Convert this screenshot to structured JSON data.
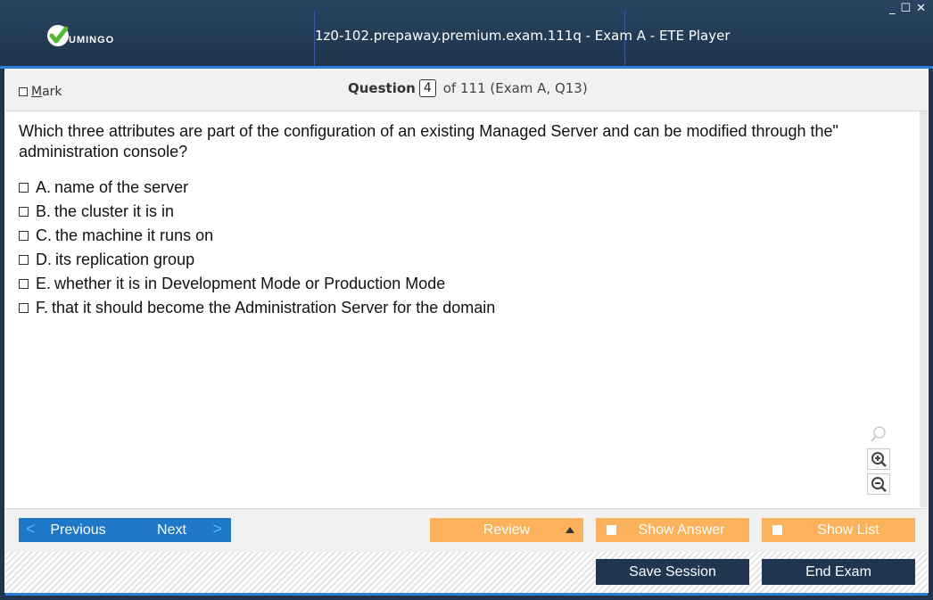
{
  "window": {
    "title": "1z0-102.prepaway.premium.exam.111q - Exam A - ETE Player",
    "brand": "UMINGO",
    "controls": {
      "minimize": "_",
      "maximize": "☐",
      "close": "✕"
    }
  },
  "question_bar": {
    "mark_label_underlined": "M",
    "mark_label_rest": "ark",
    "question_word": "Question",
    "current": "4",
    "of_text": "of 111 (Exam A, Q13)"
  },
  "question": {
    "text": "Which three attributes are part of the configuration of an existing Managed Server and can be modified through the\" administration console?",
    "answers": [
      {
        "letter": "A.",
        "text": "name of the server"
      },
      {
        "letter": "B.",
        "text": "the cluster it is in"
      },
      {
        "letter": "C.",
        "text": "the machine it runs on"
      },
      {
        "letter": "D.",
        "text": "its replication group"
      },
      {
        "letter": "E.",
        "text": "whether it is in Development Mode or Production Mode"
      },
      {
        "letter": "F.",
        "text": "that it should become the Administration Server for the domain"
      }
    ]
  },
  "toolbar": {
    "previous_label": "Previous",
    "next_label": "Next",
    "review_label": "Review",
    "show_answer_label": "Show Answer",
    "show_list_label": "Show List",
    "save_session_label": "Save Session",
    "end_exam_label": "End Exam"
  },
  "colors": {
    "header": "#1f3550",
    "accent_blue": "#1f78c7",
    "orange": "#fbb25a",
    "logo_green": "#55b831"
  }
}
